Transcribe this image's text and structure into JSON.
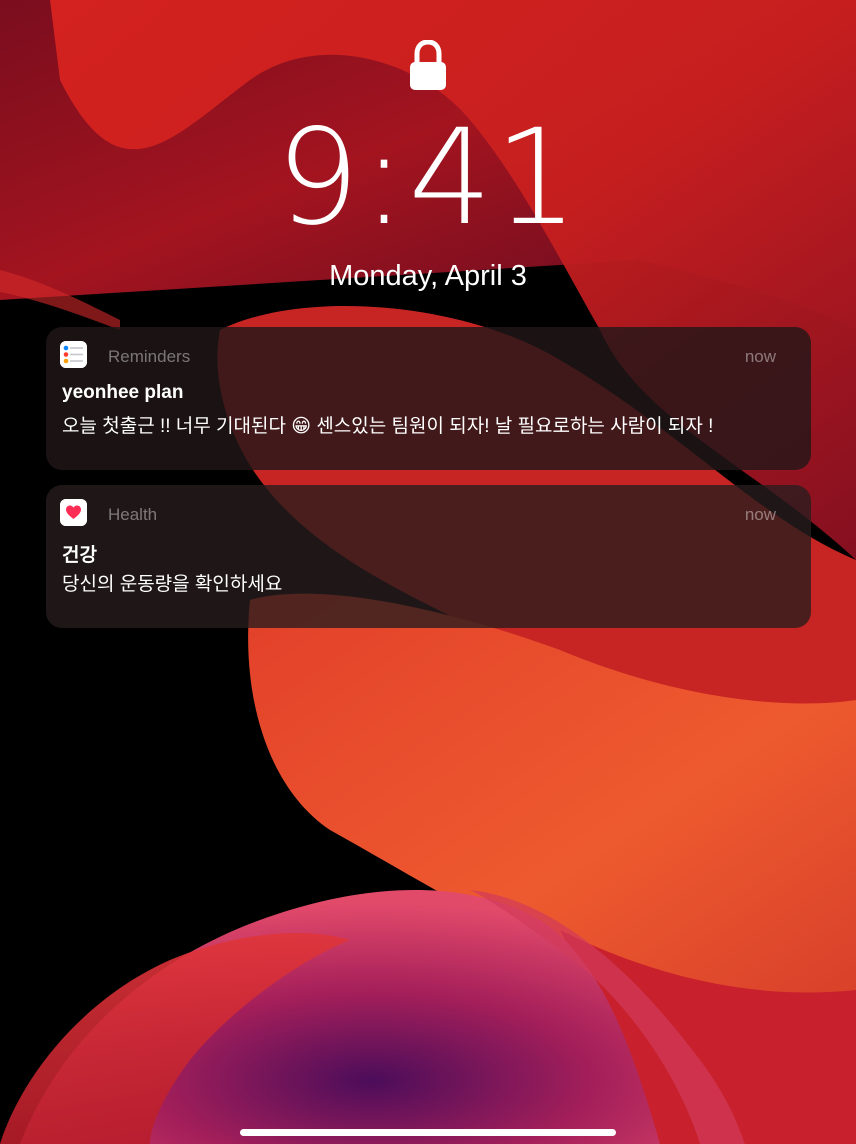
{
  "lock_screen": {
    "time": "9:41",
    "date": "Monday, April 3"
  },
  "notifications": [
    {
      "app": "Reminders",
      "icon": "reminders-icon",
      "time": "now",
      "title": "yeonhee plan",
      "body": "오늘 첫출근 !! 너무 기대된다 😁 센스있는 팀원이 되자! 날 필요로하는 사람이 되자 !"
    },
    {
      "app": "Health",
      "icon": "heart-icon",
      "time": "now",
      "title": "건강",
      "body": "당신의 운동량을 확인하세요"
    }
  ],
  "colors": {
    "wallpaper_red": "#c81f1f",
    "wallpaper_orange": "#e5552e",
    "wallpaper_magenta": "#b5225c",
    "health_heart": "#ff2d55"
  }
}
